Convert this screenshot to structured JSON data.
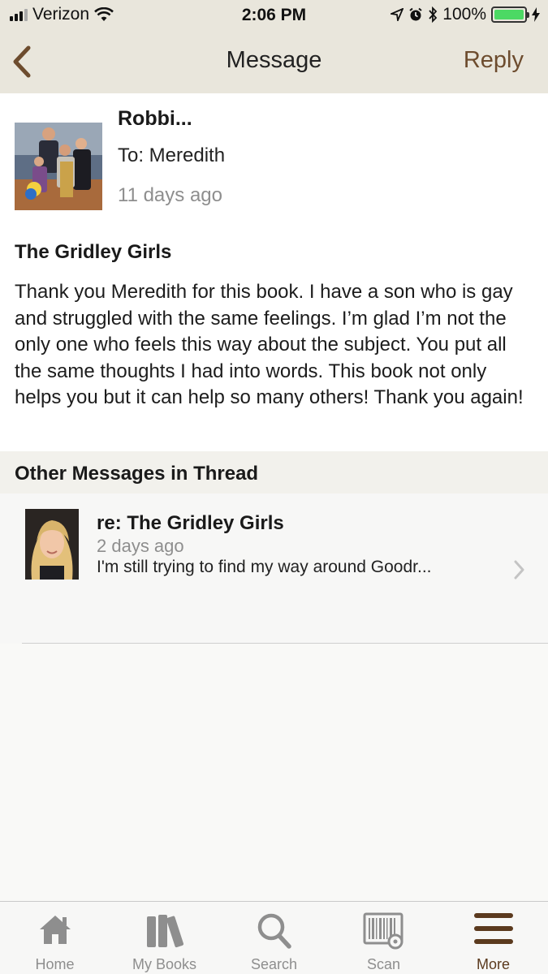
{
  "status_bar": {
    "carrier": "Verizon",
    "time": "2:06 PM",
    "battery_percent": "100%",
    "battery_level": 1.0
  },
  "nav": {
    "title": "Message",
    "reply_label": "Reply",
    "back_icon": "chevron-left-icon"
  },
  "message": {
    "sender_name": "Robbi...",
    "recipient": "To: Meredith",
    "sent_time": "11 days ago",
    "subject": "The Gridley Girls",
    "body": "Thank you Meredith for this book. I have a son who is gay and struggled with the same feelings. I’m glad I’m not the only one who feels this way about the subject. You put all the same thoughts I had into words. This book not only helps you but it can help so many others! Thank you again!"
  },
  "thread": {
    "header": "Other Messages in Thread",
    "items": [
      {
        "title": "re: The Gridley Girls",
        "time": "2 days ago",
        "snippet": "I'm still trying to find my way around Goodr..."
      }
    ]
  },
  "tabs": [
    {
      "label": "Home",
      "icon": "home-icon"
    },
    {
      "label": "My Books",
      "icon": "books-icon"
    },
    {
      "label": "Search",
      "icon": "search-icon"
    },
    {
      "label": "Scan",
      "icon": "barcode-scan-icon"
    },
    {
      "label": "More",
      "icon": "menu-icon",
      "active": true
    }
  ],
  "colors": {
    "header_bg": "#e9e6dc",
    "accent_brown": "#6d4c2e",
    "active_tab": "#5b3a1e",
    "battery_green": "#4cd964"
  }
}
